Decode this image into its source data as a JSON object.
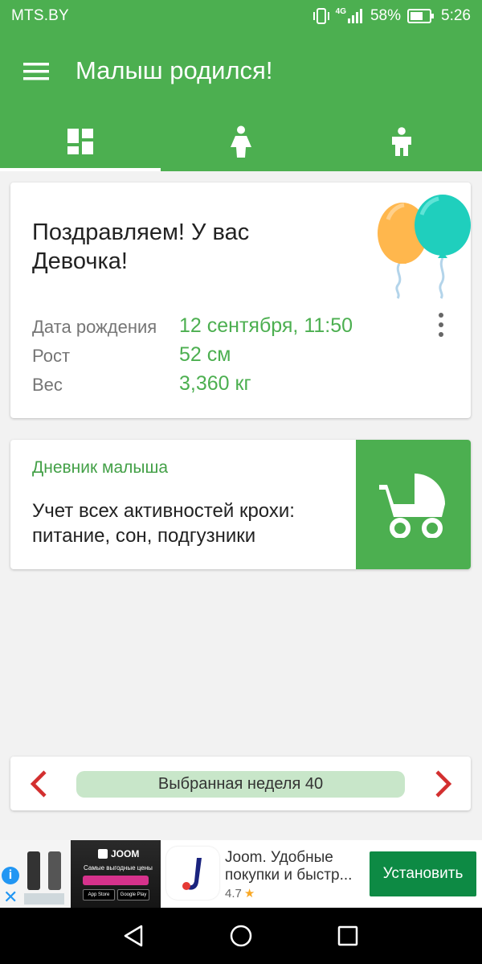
{
  "status_bar": {
    "carrier": "MTS.BY",
    "network": "4G",
    "battery": "58%",
    "time": "5:26",
    "icons": [
      "vibrate-icon",
      "signal-icon",
      "battery-icon"
    ]
  },
  "app_bar": {
    "title": "Малыш родился!",
    "menu_icon": "hamburger-menu-icon"
  },
  "tabs": [
    {
      "icon": "dashboard-icon",
      "selected": true
    },
    {
      "icon": "girl-icon",
      "selected": false
    },
    {
      "icon": "boy-icon",
      "selected": false
    }
  ],
  "birth_card": {
    "heading": "Поздравляем! У вас Девочка!",
    "illustration": "balloons-icon",
    "rows": [
      {
        "label": "Дата рождения",
        "value": "12 сентября, 11:50"
      },
      {
        "label": "Рост",
        "value": "52 см"
      },
      {
        "label": "Вес",
        "value": "3,360 кг"
      }
    ]
  },
  "diary_card": {
    "title": "Дневник малыша",
    "description": "Учет всех активностей крохи: питание, сон, подгузники",
    "action_icon": "stroller-icon"
  },
  "week_nav": {
    "label": "Выбранная неделя 40",
    "prev_icon": "chevron-left-icon",
    "next_icon": "chevron-right-icon"
  },
  "ad": {
    "brand": "JOOM",
    "tagline": "Самые выгодные цены",
    "store_badges": [
      "App Store",
      "Google Play"
    ],
    "title": "Joom. Удобные покупки и быстр...",
    "rating": "4.7",
    "install_label": "Установить"
  },
  "colors": {
    "primary": "#4caf50",
    "accent_red": "#d32f2f",
    "week_pill": "#c8e6c9",
    "install": "#0d8a44"
  }
}
